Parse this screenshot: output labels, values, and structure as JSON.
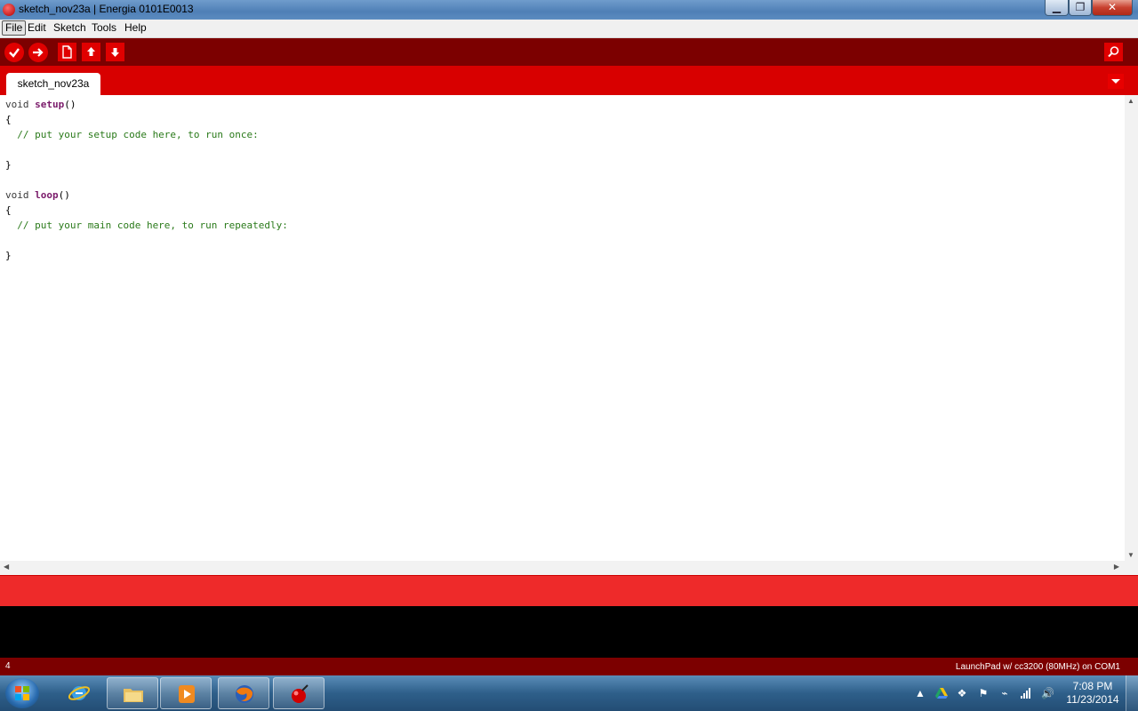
{
  "window": {
    "title": "sketch_nov23a | Energia 0101E0013",
    "minimize_glyph": "▁",
    "maximize_glyph": "❐",
    "close_glyph": "✕"
  },
  "menu": {
    "file": "File",
    "edit": "Edit",
    "sketch": "Sketch",
    "tools": "Tools",
    "help": "Help"
  },
  "toolbar": {
    "icons": [
      "check-icon",
      "arrow-right-icon",
      "new-file-icon",
      "arrow-up-icon",
      "arrow-down-icon",
      "magnifier-icon"
    ]
  },
  "tabs": [
    {
      "label": "sketch_nov23a"
    }
  ],
  "editor": {
    "lines": [
      {
        "kw": "void",
        "fn": "setup",
        "rest": "()"
      },
      {
        "text": "{"
      },
      {
        "comment": "  // put your setup code here, to run once:"
      },
      {
        "text": ""
      },
      {
        "text": "}"
      },
      {
        "text": ""
      },
      {
        "kw": "void",
        "fn": "loop",
        "rest": "()"
      },
      {
        "text": "{"
      },
      {
        "comment": "  // put your main code here, to run repeatedly:"
      },
      {
        "text": ""
      },
      {
        "text": "}"
      }
    ]
  },
  "status": {
    "line_number": "4",
    "board": "LaunchPad w/ cc3200 (80MHz) on COM1"
  },
  "taskbar": {
    "apps": [
      "internet-explorer",
      "windows-explorer",
      "media-player",
      "firefox",
      "energia"
    ]
  },
  "clock": {
    "time": "7:08 PM",
    "date": "11/23/2014"
  },
  "colors": {
    "toolbar": "#7c0000",
    "tabstrip": "#d80000",
    "message_bar": "#ee2a2a",
    "console": "#000000",
    "comment": "#2a7a1a",
    "function_name": "#7a1a6a"
  }
}
